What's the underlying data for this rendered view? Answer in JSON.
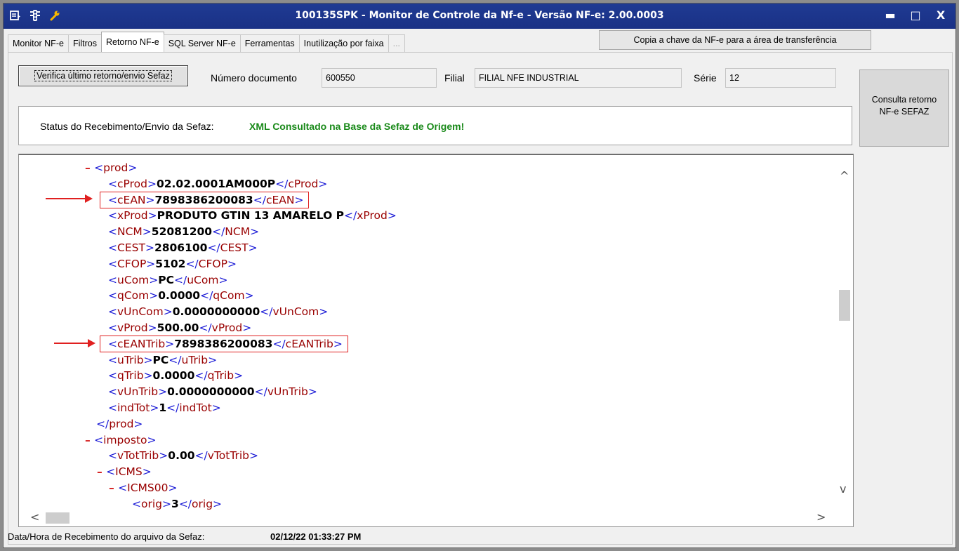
{
  "window": {
    "title": "100135SPK - Monitor de Controle da Nf-e - Versão NF-e: 2.00.0003",
    "controls": {
      "minimize": "▬",
      "maximize": "□",
      "close": "X"
    }
  },
  "tabs": [
    {
      "label": "Monitor NF-e"
    },
    {
      "label": "Filtros"
    },
    {
      "label": "Retorno NF-e",
      "active": true
    },
    {
      "label": "SQL Server NF-e"
    },
    {
      "label": "Ferramentas"
    },
    {
      "label": "Inutilização por faixa"
    },
    {
      "label": "..."
    }
  ],
  "copy_key_button": "Copia a chave da NF-e para a área de transferência",
  "form": {
    "verify_button": "Verifica último retorno/envio Sefaz",
    "numero_label": "Número documento",
    "numero_value": "600550",
    "filial_label": "Filial",
    "filial_value": "FILIAL NFE INDUSTRIAL",
    "serie_label": "Série",
    "serie_value": "12",
    "consulta_button_line1": "Consulta retorno",
    "consulta_button_line2": "NF-e SEFAZ"
  },
  "status": {
    "label": "Status do Recebimento/Envio da Sefaz:",
    "value": "XML Consultado na Base da Sefaz de Origem!"
  },
  "xml": {
    "lines": [
      {
        "indent": 0,
        "minus": true,
        "open": "prod"
      },
      {
        "indent": 1,
        "tag": "cProd",
        "value": "02.02.0001AM000P"
      },
      {
        "indent": 1,
        "tag": "cEAN",
        "value": "7898386200083",
        "highlight": true
      },
      {
        "indent": 1,
        "tag": "xProd",
        "value": "PRODUTO GTIN 13 AMARELO P"
      },
      {
        "indent": 1,
        "tag": "NCM",
        "value": "52081200"
      },
      {
        "indent": 1,
        "tag": "CEST",
        "value": "2806100"
      },
      {
        "indent": 1,
        "tag": "CFOP",
        "value": "5102"
      },
      {
        "indent": 1,
        "tag": "uCom",
        "value": "PC"
      },
      {
        "indent": 1,
        "tag": "qCom",
        "value": "0.0000"
      },
      {
        "indent": 1,
        "tag": "vUnCom",
        "value": "0.0000000000"
      },
      {
        "indent": 1,
        "tag": "vProd",
        "value": "500.00"
      },
      {
        "indent": 1,
        "tag": "cEANTrib",
        "value": "7898386200083",
        "highlight": true
      },
      {
        "indent": 1,
        "tag": "uTrib",
        "value": "PC"
      },
      {
        "indent": 1,
        "tag": "qTrib",
        "value": "0.0000"
      },
      {
        "indent": 1,
        "tag": "vUnTrib",
        "value": "0.0000000000"
      },
      {
        "indent": 1,
        "tag": "indTot",
        "value": "1"
      },
      {
        "indent": 0,
        "close": "prod"
      },
      {
        "indent": 0,
        "minus": true,
        "open": "imposto"
      },
      {
        "indent": 1,
        "tag": "vTotTrib",
        "value": "0.00"
      },
      {
        "indent": 1,
        "minus": true,
        "open": "ICMS"
      },
      {
        "indent": 2,
        "minus": true,
        "open": "ICMS00"
      },
      {
        "indent": 3,
        "tag": "orig",
        "value": "3"
      }
    ]
  },
  "footer": {
    "label": "Data/Hora de Recebimento do arquivo da Sefaz:",
    "value": "02/12/22 01:33:27 PM"
  },
  "colors": {
    "title_bar": "#1f3a93",
    "bracket": "#1a1ad6",
    "tag_name": "#990000",
    "status_ok": "#1a8a1a",
    "highlight": "#e02020"
  },
  "icons": [
    "menu-icon",
    "traffic-light-icon",
    "wrench-icon"
  ]
}
